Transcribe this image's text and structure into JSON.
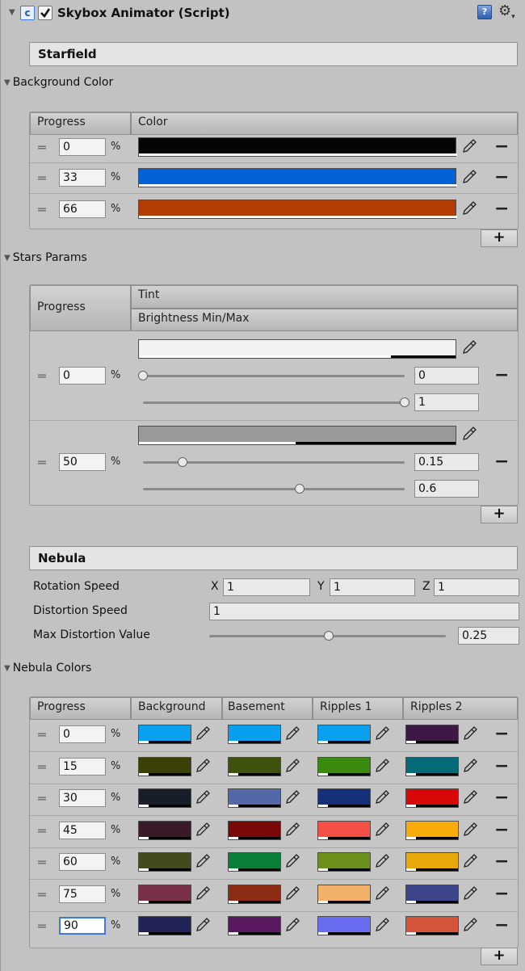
{
  "header": {
    "title": "Skybox Animator (Script)",
    "enabled": true
  },
  "starfield": {
    "section_label": "Starfield",
    "background_color": {
      "foldout_label": "Background Color",
      "columns": [
        "Progress",
        "Color"
      ],
      "rows": [
        {
          "progress": "0",
          "color": "#050505"
        },
        {
          "progress": "33",
          "color": "#0062d6"
        },
        {
          "progress": "66",
          "color": "#b33d04"
        }
      ],
      "pct": "%"
    },
    "stars_params": {
      "foldout_label": "Stars Params",
      "columns": [
        "Progress",
        "Tint",
        "Brightness Min/Max"
      ],
      "rows": [
        {
          "progress": "0",
          "tint": "#f2f2f2",
          "min": "0",
          "max": "1",
          "min_level": 0.0,
          "max_level": 1.0
        },
        {
          "progress": "50",
          "tint": "#9a9a9a",
          "min": "0.15",
          "max": "0.6",
          "min_level": 0.15,
          "max_level": 0.6
        }
      ],
      "pct": "%"
    }
  },
  "nebula": {
    "section_label": "Nebula",
    "rotation_speed": {
      "label": "Rotation Speed",
      "x_label": "X",
      "x": "1",
      "y_label": "Y",
      "y": "1",
      "z_label": "Z",
      "z": "1"
    },
    "distortion_speed": {
      "label": "Distortion Speed",
      "value": "1"
    },
    "max_distortion": {
      "label": "Max Distortion Value",
      "value": "0.25",
      "level": 0.25
    },
    "colors": {
      "foldout_label": "Nebula Colors",
      "columns": [
        "Progress",
        "Background",
        "Basement",
        "Ripples 1",
        "Ripples 2"
      ],
      "pct": "%",
      "rows": [
        {
          "progress": "0",
          "colors": [
            "#0aa0f0",
            "#08a0ee",
            "#0aa0f0",
            "#3c1a45"
          ]
        },
        {
          "progress": "15",
          "colors": [
            "#3a4006",
            "#3e520d",
            "#3b8a0f",
            "#056a78"
          ]
        },
        {
          "progress": "30",
          "colors": [
            "#171d29",
            "#5268a8",
            "#143078",
            "#d80808"
          ]
        },
        {
          "progress": "45",
          "colors": [
            "#3a1a28",
            "#7a0808",
            "#f55048",
            "#f7ac0a"
          ]
        },
        {
          "progress": "60",
          "colors": [
            "#45491e",
            "#0a7f3a",
            "#6d8f1c",
            "#e7a90a"
          ]
        },
        {
          "progress": "75",
          "colors": [
            "#7a2f48",
            "#8c2c14",
            "#f2b069",
            "#3c4589"
          ]
        },
        {
          "progress": "90",
          "colors": [
            "#222458",
            "#5a1860",
            "#6a6cf2",
            "#d5553a"
          ]
        }
      ]
    }
  },
  "icons": {
    "foldout": "triangle-down-icon",
    "script": "script-icon",
    "help": "help-book-icon",
    "settings": "gear-icon",
    "picker": "eyedropper-icon",
    "handle": "drag-handle-icon"
  }
}
